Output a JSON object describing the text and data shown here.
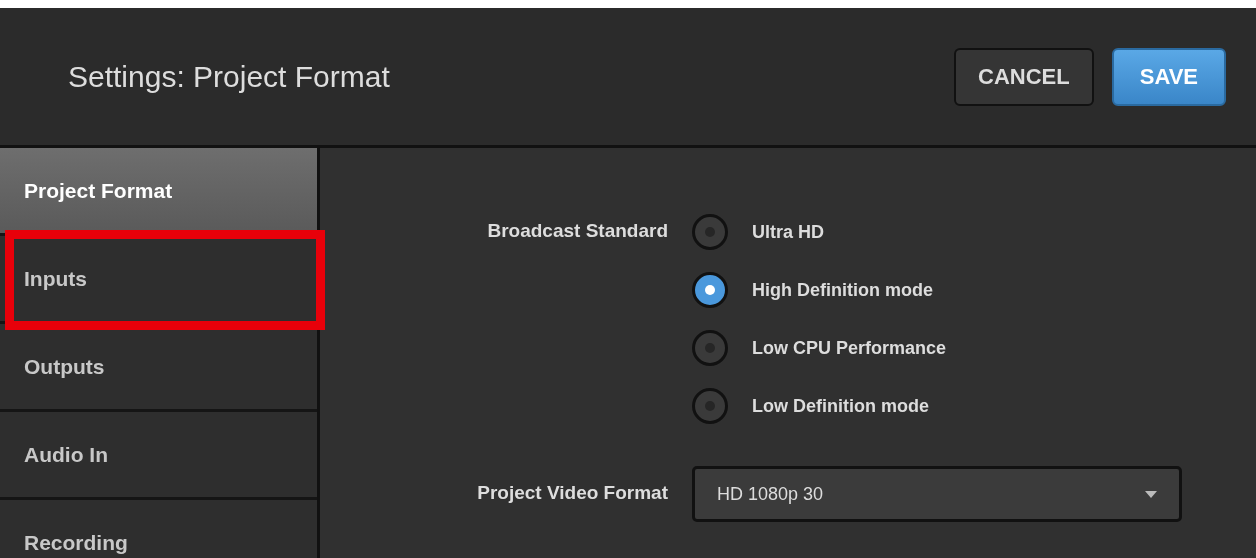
{
  "header": {
    "title": "Settings: Project Format",
    "buttons": [
      {
        "label": "CANCEL",
        "kind": "secondary"
      },
      {
        "label": "SAVE",
        "kind": "primary"
      }
    ]
  },
  "sidebar": {
    "items": [
      {
        "label": "Project Format",
        "selected": true,
        "highlighted": false
      },
      {
        "label": "Inputs",
        "selected": false,
        "highlighted": true
      },
      {
        "label": "Outputs",
        "selected": false,
        "highlighted": false
      },
      {
        "label": "Audio In",
        "selected": false,
        "highlighted": false
      },
      {
        "label": "Recording",
        "selected": false,
        "highlighted": false
      }
    ]
  },
  "broadcast_standard": {
    "label": "Broadcast Standard",
    "options": [
      {
        "label": "Ultra HD",
        "selected": false
      },
      {
        "label": "High Definition mode",
        "selected": true
      },
      {
        "label": "Low CPU Performance",
        "selected": false
      },
      {
        "label": "Low Definition mode",
        "selected": false
      }
    ]
  },
  "project_video_format": {
    "label": "Project Video Format",
    "value": "HD 1080p 30"
  }
}
